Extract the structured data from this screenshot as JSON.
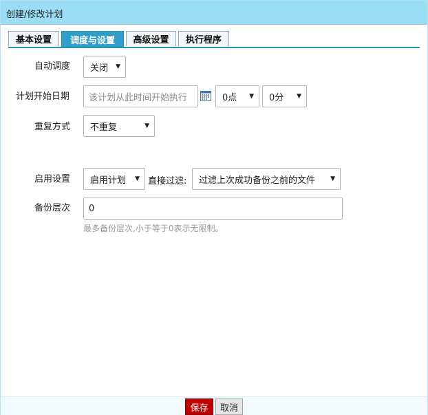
{
  "dialog": {
    "title": "创建/修改计划"
  },
  "tabs": [
    {
      "label": "基本设置",
      "active": false
    },
    {
      "label": "调度与设置",
      "active": true
    },
    {
      "label": "高级设置",
      "active": false
    },
    {
      "label": "执行程序",
      "active": false
    }
  ],
  "form": {
    "auto_schedule": {
      "label": "自动调度",
      "value": "关闭"
    },
    "start_date": {
      "label": "计划开始日期",
      "placeholder": "该计划从此时间开始执行",
      "hour_value": "0点",
      "minute_value": "0分"
    },
    "repeat": {
      "label": "重复方式",
      "value": "不重复"
    },
    "enable": {
      "label": "启用设置",
      "value": "启用计划",
      "filter_label": "直接过滤:",
      "filter_value": "过滤上次成功备份之前的文件"
    },
    "backup_levels": {
      "label": "备份层次",
      "value": "0",
      "hint": "最多备份层次,小于等于0表示无限制。"
    }
  },
  "footer": {
    "save_label": "保存",
    "cancel_label": "取消"
  },
  "colors": {
    "titlebar": "#99def4",
    "active_tab": "#2f9fc9",
    "save_button": "#c00000"
  },
  "icons": {
    "calendar": "calendar-icon",
    "dropdown": "chevron-down-icon"
  }
}
